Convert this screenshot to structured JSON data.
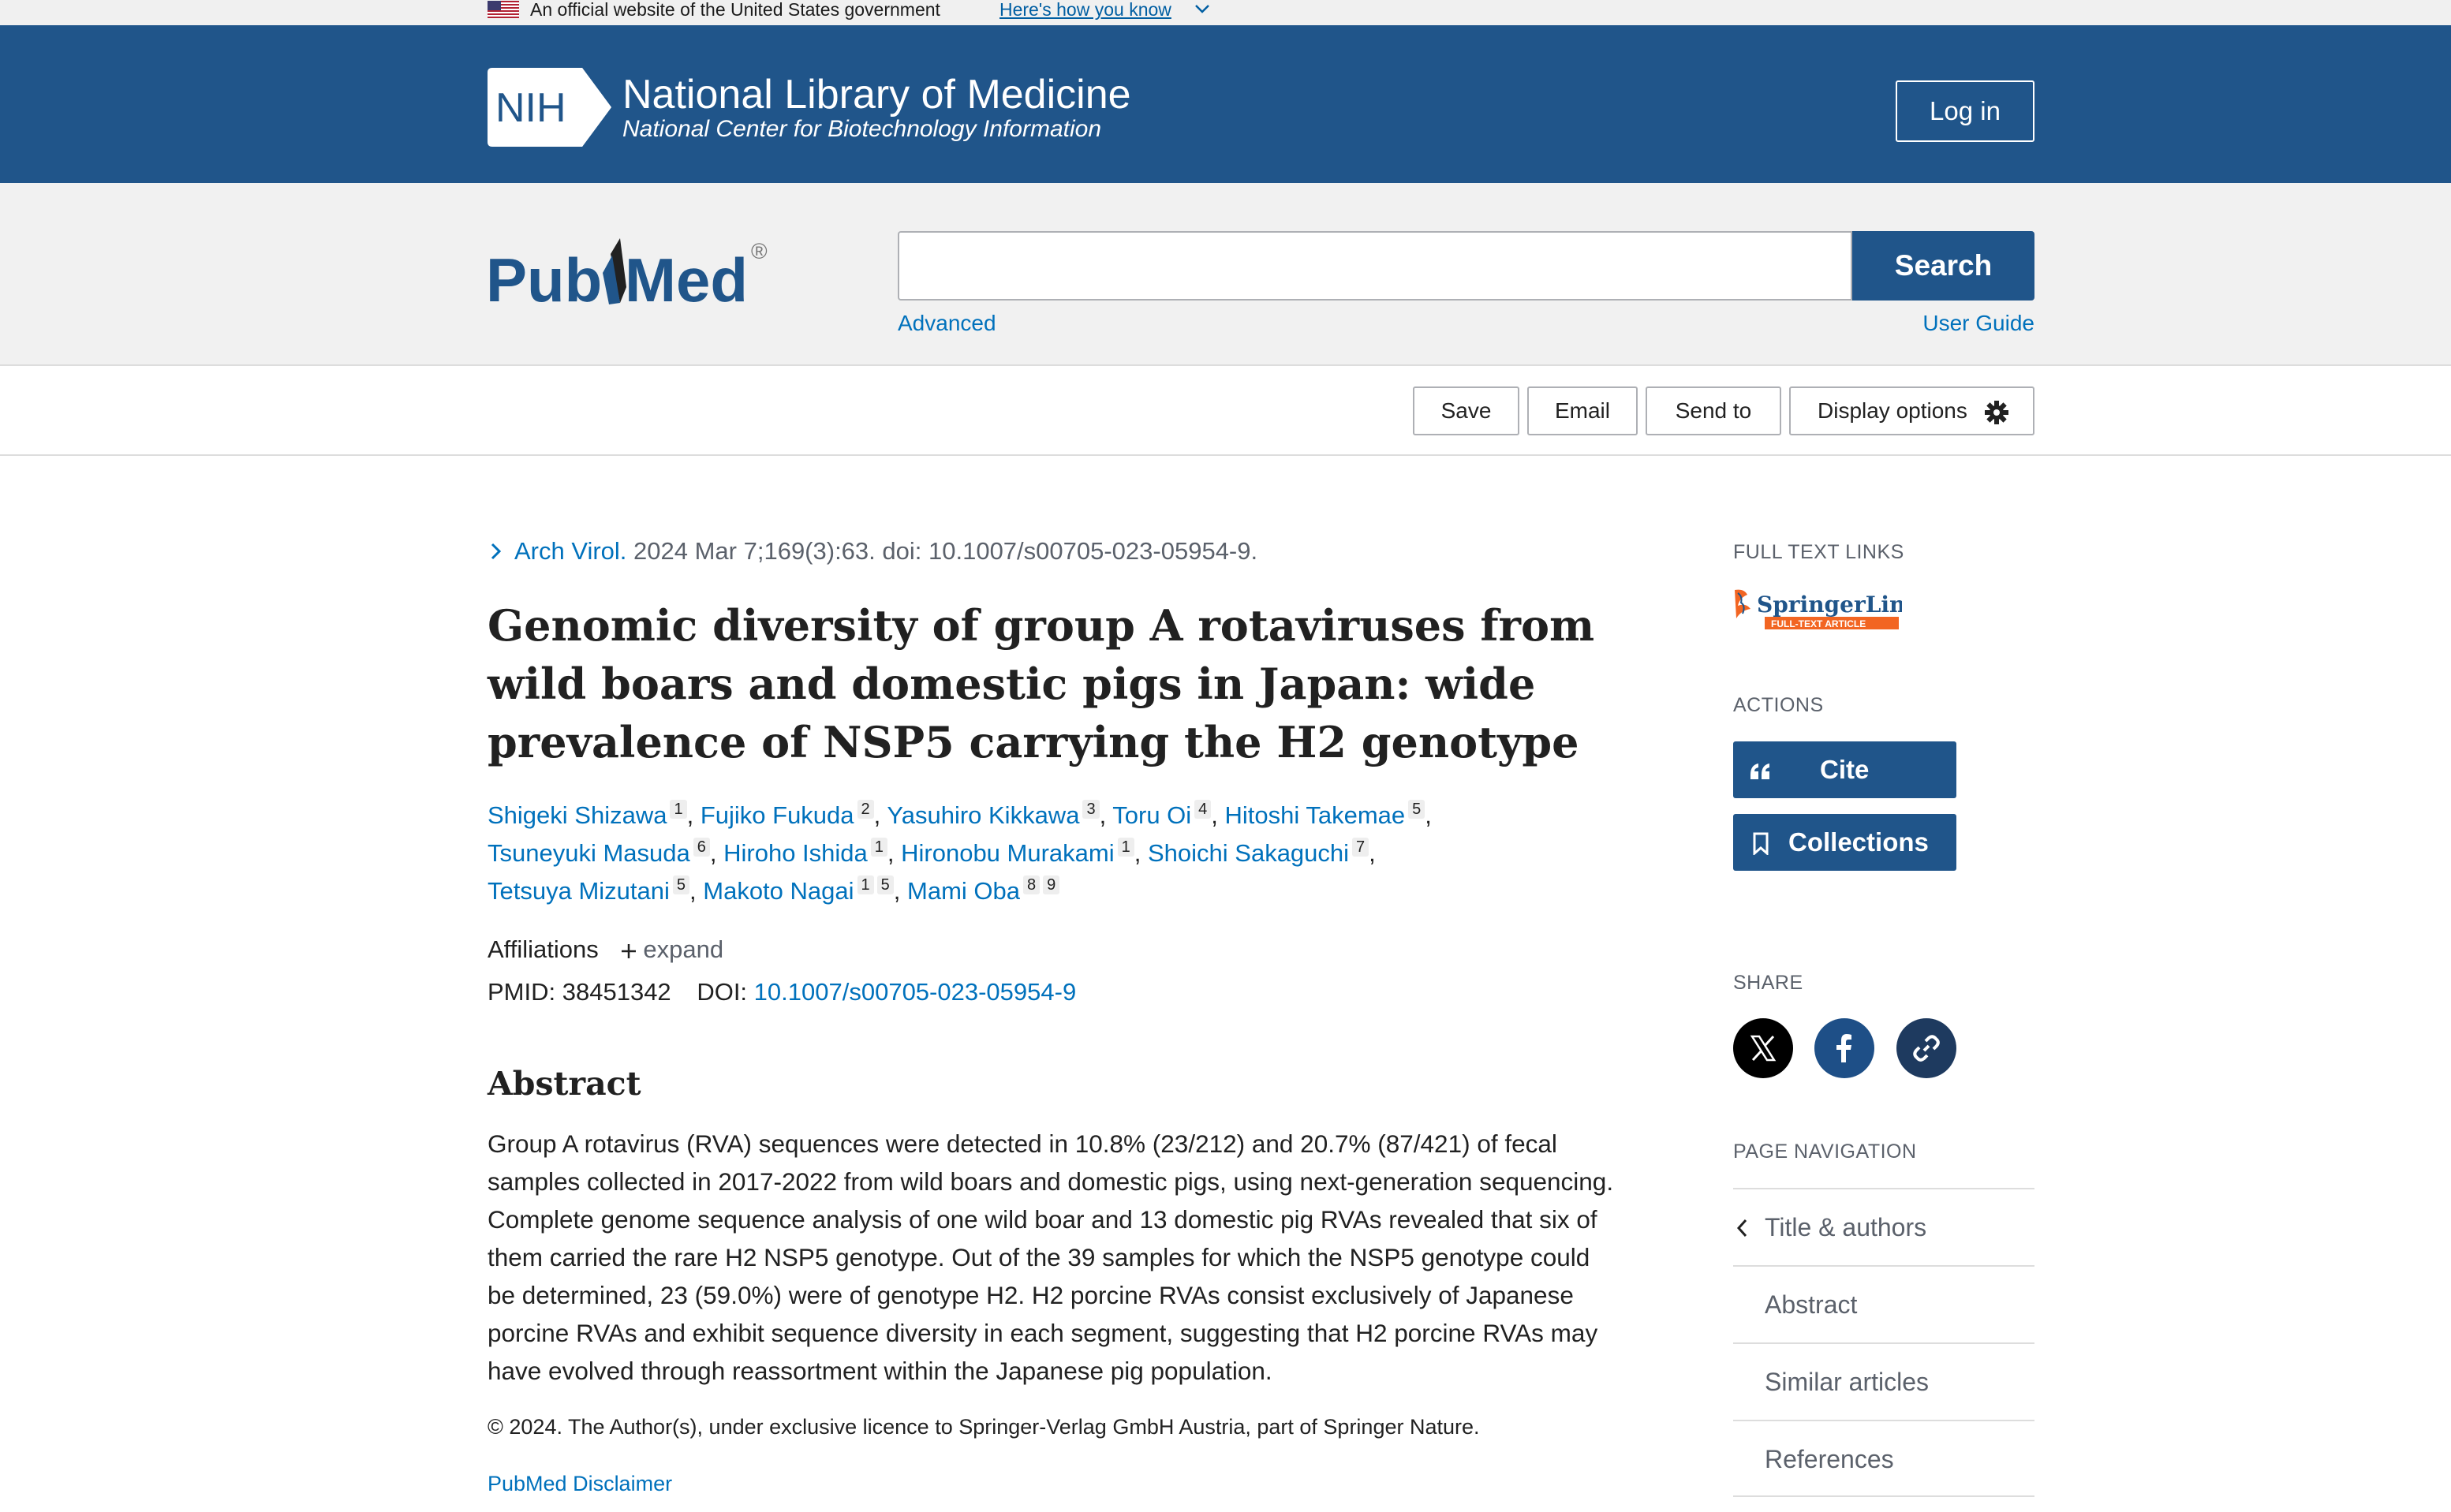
{
  "gov_banner": {
    "official_text": "An official website of the United States government",
    "how_link": "Here's how you know"
  },
  "header": {
    "logo_text": "NIH",
    "title": "National Library of Medicine",
    "subtitle": "National Center for Biotechnology Information",
    "login_label": "Log in",
    "color": "#20558a"
  },
  "search": {
    "logo": "PubMed",
    "placeholder": "",
    "button_label": "Search",
    "advanced_label": "Advanced",
    "user_guide_label": "User Guide"
  },
  "toolbar": {
    "save_label": "Save",
    "email_label": "Email",
    "send_label": "Send to",
    "display_label": "Display options"
  },
  "article": {
    "journal": "Arch Virol.",
    "citation": " 2024 Mar 7;169(3):63. doi: 10.1007/s00705-023-05954-9.",
    "title": "Genomic diversity of group A rotaviruses from wild boars and domestic pigs in Japan: wide prevalence of NSP5 carrying the H2 genotype",
    "authors": [
      {
        "name": "Shigeki Shizawa",
        "aff": "1"
      },
      {
        "name": "Fujiko Fukuda",
        "aff": "2"
      },
      {
        "name": "Yasuhiro Kikkawa",
        "aff": "3"
      },
      {
        "name": "Toru Oi",
        "aff": "4"
      },
      {
        "name": "Hitoshi Takemae",
        "aff": "5"
      },
      {
        "name": "Tsuneyuki Masuda",
        "aff": "6"
      },
      {
        "name": "Hiroho Ishida",
        "aff": "1"
      },
      {
        "name": "Hironobu Murakami",
        "aff": "1"
      },
      {
        "name": "Shoichi Sakaguchi",
        "aff": "7"
      },
      {
        "name": "Tetsuya Mizutani",
        "aff": "5"
      },
      {
        "name": "Makoto Nagai",
        "aff": "1",
        "aff2": "5"
      },
      {
        "name": "Mami Oba",
        "aff": "8",
        "aff2": "9"
      }
    ],
    "affiliations_label": "Affiliations",
    "expand_label": "expand",
    "pmid_label": "PMID:",
    "pmid": "38451342",
    "doi_label": "DOI:",
    "doi": "10.1007/s00705-023-05954-9",
    "abstract_heading": "Abstract",
    "abstract": "Group A rotavirus (RVA) sequences were detected in 10.8% (23/212) and 20.7% (87/421) of fecal samples collected in 2017-2022 from wild boars and domestic pigs, using next-generation sequencing. Complete genome sequence analysis of one wild boar and 13 domestic pig RVAs revealed that six of them carried the rare H2 NSP5 genotype. Out of the 39 samples for which the NSP5 genotype could be determined, 23 (59.0%) were of genotype H2. H2 porcine RVAs consist exclusively of Japanese porcine RVAs and exhibit sequence diversity in each segment, suggesting that H2 porcine RVAs may have evolved through reassortment within the Japanese pig population.",
    "copyright": "© 2024. The Author(s), under exclusive licence to Springer-Verlag GmbH Austria, part of Springer Nature.",
    "disclaimer": "PubMed Disclaimer"
  },
  "sidebar": {
    "full_text_heading": "FULL TEXT LINKS",
    "springer_name": "SpringerLink",
    "springer_badge": "FULL-TEXT ARTICLE",
    "actions_heading": "ACTIONS",
    "cite_label": "Cite",
    "collections_label": "Collections",
    "share_heading": "SHARE",
    "page_nav_heading": "PAGE NAVIGATION",
    "nav_items": [
      "Title & authors",
      "Abstract",
      "Similar articles",
      "References"
    ]
  }
}
